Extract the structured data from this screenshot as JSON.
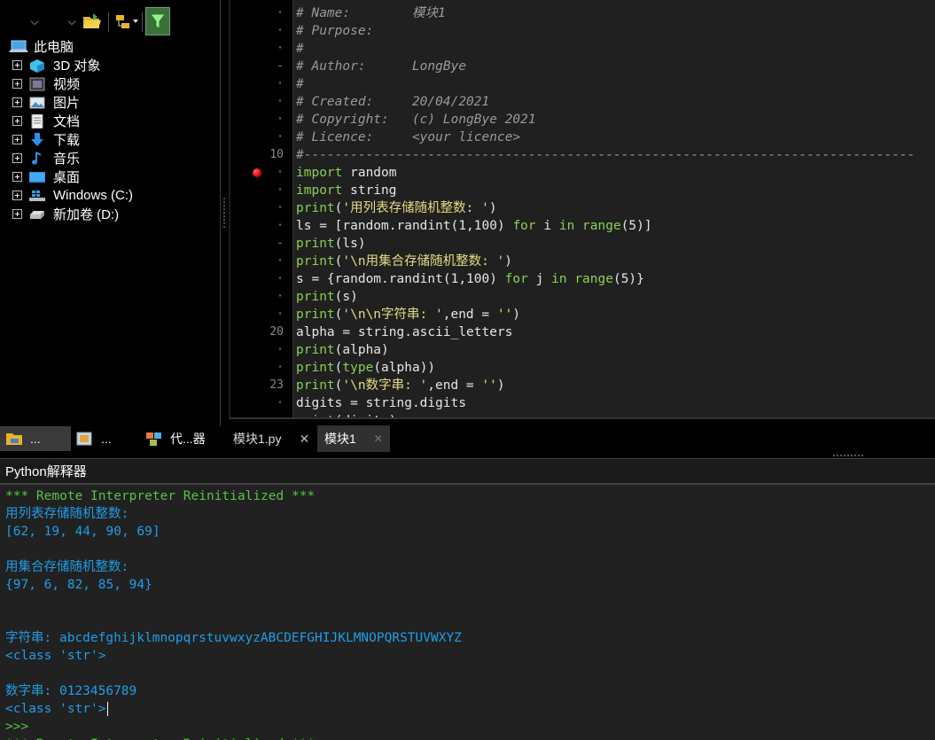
{
  "explorer": {
    "toolbar": {
      "dropdown1": "⌵",
      "dropdown2": "⌵"
    },
    "root_label": "此电脑",
    "items": [
      {
        "label": "3D 对象",
        "icon": "3d-objects-icon"
      },
      {
        "label": "视频",
        "icon": "video-icon"
      },
      {
        "label": "图片",
        "icon": "pictures-icon"
      },
      {
        "label": "文档",
        "icon": "documents-icon"
      },
      {
        "label": "下载",
        "icon": "download-icon"
      },
      {
        "label": "音乐",
        "icon": "music-icon"
      },
      {
        "label": "桌面",
        "icon": "desktop-icon"
      },
      {
        "label": "Windows (C:)",
        "icon": "drive-icon"
      },
      {
        "label": "新加卷 (D:)",
        "icon": "drive-icon"
      }
    ]
  },
  "left_tabs": [
    {
      "label": "...",
      "icon": "folder-icon"
    },
    {
      "label": "...",
      "icon": "project-icon"
    },
    {
      "label": "代...器",
      "icon": "code-explorer-icon"
    }
  ],
  "editor": {
    "gutter": [
      {
        "n": "·"
      },
      {
        "n": "·"
      },
      {
        "n": "·"
      },
      {
        "n": "-"
      },
      {
        "n": "·"
      },
      {
        "n": "·"
      },
      {
        "n": "·"
      },
      {
        "n": "·"
      },
      {
        "n": "10"
      },
      {
        "n": "·"
      },
      {
        "n": "·"
      },
      {
        "n": "·"
      },
      {
        "n": "·"
      },
      {
        "n": "-"
      },
      {
        "n": "·"
      },
      {
        "n": "·"
      },
      {
        "n": "·"
      },
      {
        "n": "·"
      },
      {
        "n": "20"
      },
      {
        "n": "·"
      },
      {
        "n": "·"
      },
      {
        "n": "23"
      },
      {
        "n": "·"
      }
    ],
    "lines": [
      [
        {
          "c": "cm",
          "t": "# Name:        模块1"
        }
      ],
      [
        {
          "c": "cm",
          "t": "# Purpose:"
        }
      ],
      [
        {
          "c": "cm",
          "t": "#"
        }
      ],
      [
        {
          "c": "cm",
          "t": "# Author:      LongBye"
        }
      ],
      [
        {
          "c": "cm",
          "t": "#"
        }
      ],
      [
        {
          "c": "cm",
          "t": "# Created:     20/04/2021"
        }
      ],
      [
        {
          "c": "cm",
          "t": "# Copyright:   (c) LongBye 2021"
        }
      ],
      [
        {
          "c": "cm",
          "t": "# Licence:     <your licence>"
        }
      ],
      [
        {
          "c": "cm",
          "t": "#-------------------------------------------------------------------------------"
        }
      ],
      [
        {
          "c": "kw",
          "t": "import"
        },
        {
          "c": "nm",
          "t": " random"
        }
      ],
      [
        {
          "c": "kw",
          "t": "import"
        },
        {
          "c": "nm",
          "t": " string"
        }
      ],
      [
        {
          "c": "fn",
          "t": "print"
        },
        {
          "c": "nm",
          "t": "("
        },
        {
          "c": "st",
          "t": "'用列表存储随机整数: '"
        },
        {
          "c": "nm",
          "t": ")"
        }
      ],
      [
        {
          "c": "nm",
          "t": "ls = [random.randint(1,100) "
        },
        {
          "c": "kw",
          "t": "for"
        },
        {
          "c": "nm",
          "t": " i "
        },
        {
          "c": "kw",
          "t": "in"
        },
        {
          "c": "nm",
          "t": " "
        },
        {
          "c": "fn",
          "t": "range"
        },
        {
          "c": "nm",
          "t": "(5)]"
        }
      ],
      [
        {
          "c": "fn",
          "t": "print"
        },
        {
          "c": "nm",
          "t": "(ls)"
        }
      ],
      [
        {
          "c": "fn",
          "t": "print"
        },
        {
          "c": "nm",
          "t": "("
        },
        {
          "c": "st",
          "t": "'\\n用集合存储随机整数: '"
        },
        {
          "c": "nm",
          "t": ")"
        }
      ],
      [
        {
          "c": "nm",
          "t": "s = {random.randint(1,100) "
        },
        {
          "c": "kw",
          "t": "for"
        },
        {
          "c": "nm",
          "t": " j "
        },
        {
          "c": "kw",
          "t": "in"
        },
        {
          "c": "nm",
          "t": " "
        },
        {
          "c": "fn",
          "t": "range"
        },
        {
          "c": "nm",
          "t": "(5)}"
        }
      ],
      [
        {
          "c": "fn",
          "t": "print"
        },
        {
          "c": "nm",
          "t": "(s)"
        }
      ],
      [
        {
          "c": "fn",
          "t": "print"
        },
        {
          "c": "nm",
          "t": "("
        },
        {
          "c": "st",
          "t": "'\\n\\n字符串: '"
        },
        {
          "c": "nm",
          "t": ",end = "
        },
        {
          "c": "st",
          "t": "''"
        },
        {
          "c": "nm",
          "t": ")"
        }
      ],
      [
        {
          "c": "nm",
          "t": "alpha = string.ascii_letters"
        }
      ],
      [
        {
          "c": "fn",
          "t": "print"
        },
        {
          "c": "nm",
          "t": "(alpha)"
        }
      ],
      [
        {
          "c": "fn",
          "t": "print"
        },
        {
          "c": "nm",
          "t": "("
        },
        {
          "c": "fn",
          "t": "type"
        },
        {
          "c": "nm",
          "t": "(alpha))"
        }
      ],
      [
        {
          "c": "fn",
          "t": "print"
        },
        {
          "c": "nm",
          "t": "("
        },
        {
          "c": "st",
          "t": "'\\n数字串: '"
        },
        {
          "c": "nm",
          "t": ",end = "
        },
        {
          "c": "st",
          "t": "''"
        },
        {
          "c": "nm",
          "t": ")"
        }
      ],
      [
        {
          "c": "nm",
          "t": "digits = string.digits"
        }
      ],
      [
        {
          "c": "fn",
          "t": "print"
        },
        {
          "c": "nm",
          "t": "(digits)"
        }
      ]
    ],
    "breakpoint_line": "10"
  },
  "editor_tabs": [
    {
      "label": "模块1.py",
      "close": "✕"
    },
    {
      "label": "模块1",
      "close": "✕"
    }
  ],
  "interpreter": {
    "title": "Python解释器",
    "lines": [
      {
        "t": "*** Remote Interpreter Reinitialized ***",
        "c": "green"
      },
      {
        "t": "用列表存储随机整数:",
        "c": ""
      },
      {
        "t": "[62, 19, 44, 90, 69]",
        "c": ""
      },
      {
        "t": "",
        "c": ""
      },
      {
        "t": "用集合存储随机整数:",
        "c": ""
      },
      {
        "t": "{97, 6, 82, 85, 94}",
        "c": ""
      },
      {
        "t": "",
        "c": ""
      },
      {
        "t": "",
        "c": ""
      },
      {
        "t": "字符串: abcdefghijklmnopqrstuvwxyzABCDEFGHIJKLMNOPQRSTUVWXYZ",
        "c": ""
      },
      {
        "t": "<class 'str'>",
        "c": ""
      },
      {
        "t": "",
        "c": ""
      },
      {
        "t": "数字串: 0123456789",
        "c": ""
      },
      {
        "t": "<class 'str'>",
        "c": "",
        "caret": true
      },
      {
        "t": ">>>",
        "c": "green"
      },
      {
        "t": "*** Remote Interpreter Reinitialized ***",
        "c": "green"
      }
    ]
  },
  "colors": {
    "keyword": "#8ad052",
    "string": "#e2de82",
    "comment": "#9a9a9a",
    "output": "#1e9ee8",
    "prompt": "#5ac04a",
    "breakpoint": "#e00000"
  }
}
